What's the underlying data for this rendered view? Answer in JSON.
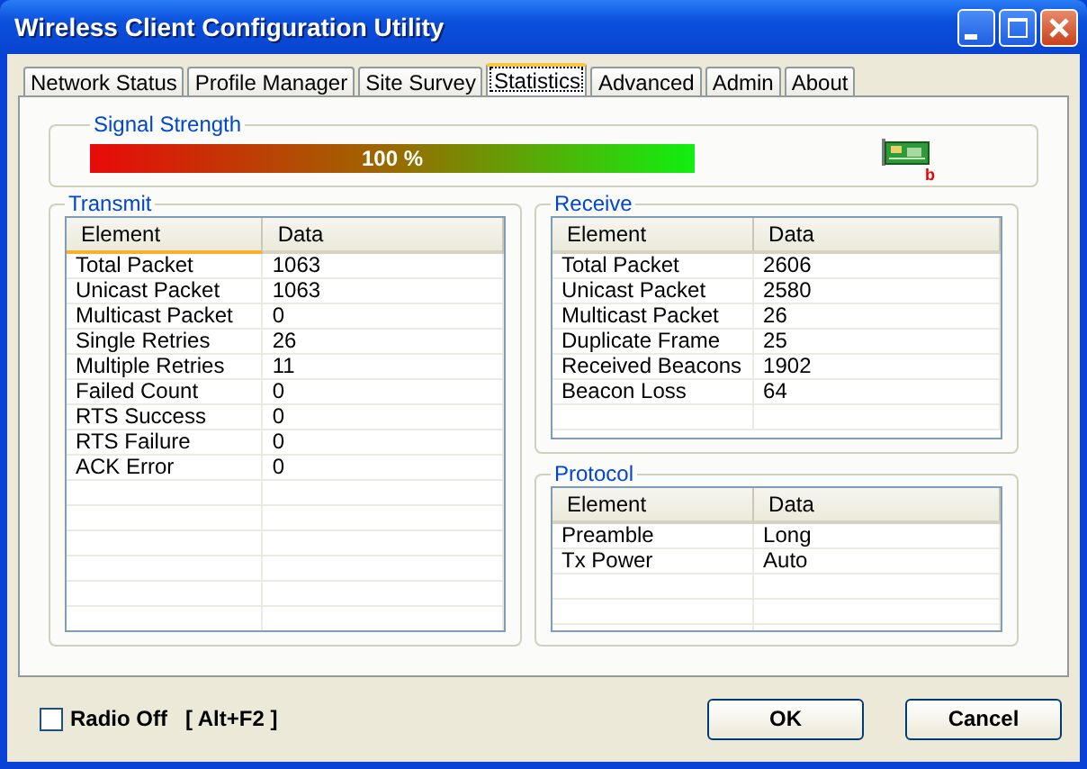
{
  "window": {
    "title": "Wireless Client Configuration Utility"
  },
  "tabs": [
    {
      "label": "Network Status",
      "selected": false
    },
    {
      "label": "Profile Manager",
      "selected": false
    },
    {
      "label": "Site Survey",
      "selected": false
    },
    {
      "label": "Statistics",
      "selected": true
    },
    {
      "label": "Advanced",
      "selected": false
    },
    {
      "label": "Admin",
      "selected": false
    },
    {
      "label": "About",
      "selected": false
    }
  ],
  "signal": {
    "title": "Signal Strength",
    "level": 1.0,
    "reading": "100 %",
    "card_badge": "b"
  },
  "transmit": {
    "title": "Transmit",
    "columns": [
      "Element",
      "Data"
    ],
    "rows": [
      [
        "Total Packet",
        "1063"
      ],
      [
        "Unicast Packet",
        "1063"
      ],
      [
        "Multicast Packet",
        "0"
      ],
      [
        "Single Retries",
        "26"
      ],
      [
        "Multiple Retries",
        "11"
      ],
      [
        "Failed Count",
        "0"
      ],
      [
        "RTS Success",
        "0"
      ],
      [
        "RTS Failure",
        "0"
      ],
      [
        "ACK Error",
        "0"
      ]
    ]
  },
  "receive": {
    "title": "Receive",
    "columns": [
      "Element",
      "Data"
    ],
    "rows": [
      [
        "Total Packet",
        "2606"
      ],
      [
        "Unicast Packet",
        "2580"
      ],
      [
        "Multicast Packet",
        "26"
      ],
      [
        "Duplicate Frame",
        "25"
      ],
      [
        "Received Beacons",
        "1902"
      ],
      [
        "Beacon Loss",
        "64"
      ]
    ]
  },
  "protocol": {
    "title": "Protocol",
    "columns": [
      "Element",
      "Data"
    ],
    "rows": [
      [
        "Preamble",
        "Long"
      ],
      [
        "Tx Power",
        "Auto"
      ]
    ]
  },
  "radio_off": {
    "label": "Radio Off",
    "shortcut": "[ Alt+F2 ]",
    "checked": false
  },
  "buttons": [
    "OK",
    "Cancel"
  ]
}
